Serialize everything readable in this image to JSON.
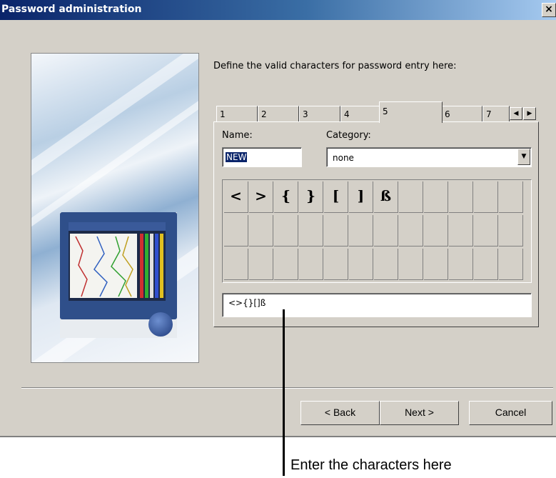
{
  "window": {
    "title": "Password administration",
    "close_label": "×"
  },
  "instruction": "Define the valid characters for password entry here:",
  "tabs": [
    {
      "label": "1"
    },
    {
      "label": "2"
    },
    {
      "label": "3"
    },
    {
      "label": "4"
    },
    {
      "label": "5",
      "active": true
    },
    {
      "label": "6"
    },
    {
      "label": "7"
    }
  ],
  "tab_scroll": {
    "left": "◀",
    "right": "▶"
  },
  "name_field": {
    "label": "Name:",
    "value": "NEW"
  },
  "category_field": {
    "label": "Category:",
    "selected": "none",
    "dropdown_arrow": "▼"
  },
  "char_grid": {
    "columns": 12,
    "rows": 3,
    "chars": [
      "<",
      ">",
      "{",
      "}",
      "[",
      "]",
      "ß"
    ]
  },
  "char_entry": {
    "value": "<>{}[]ß"
  },
  "buttons": {
    "back": "< Back",
    "next": "Next >",
    "cancel": "Cancel"
  },
  "callout": {
    "text": "Enter the characters here"
  },
  "colors": {
    "dialog_bg": "#d4d0c8",
    "title_start": "#0a246a",
    "title_end": "#a6caf0",
    "selection": "#0a246a"
  }
}
